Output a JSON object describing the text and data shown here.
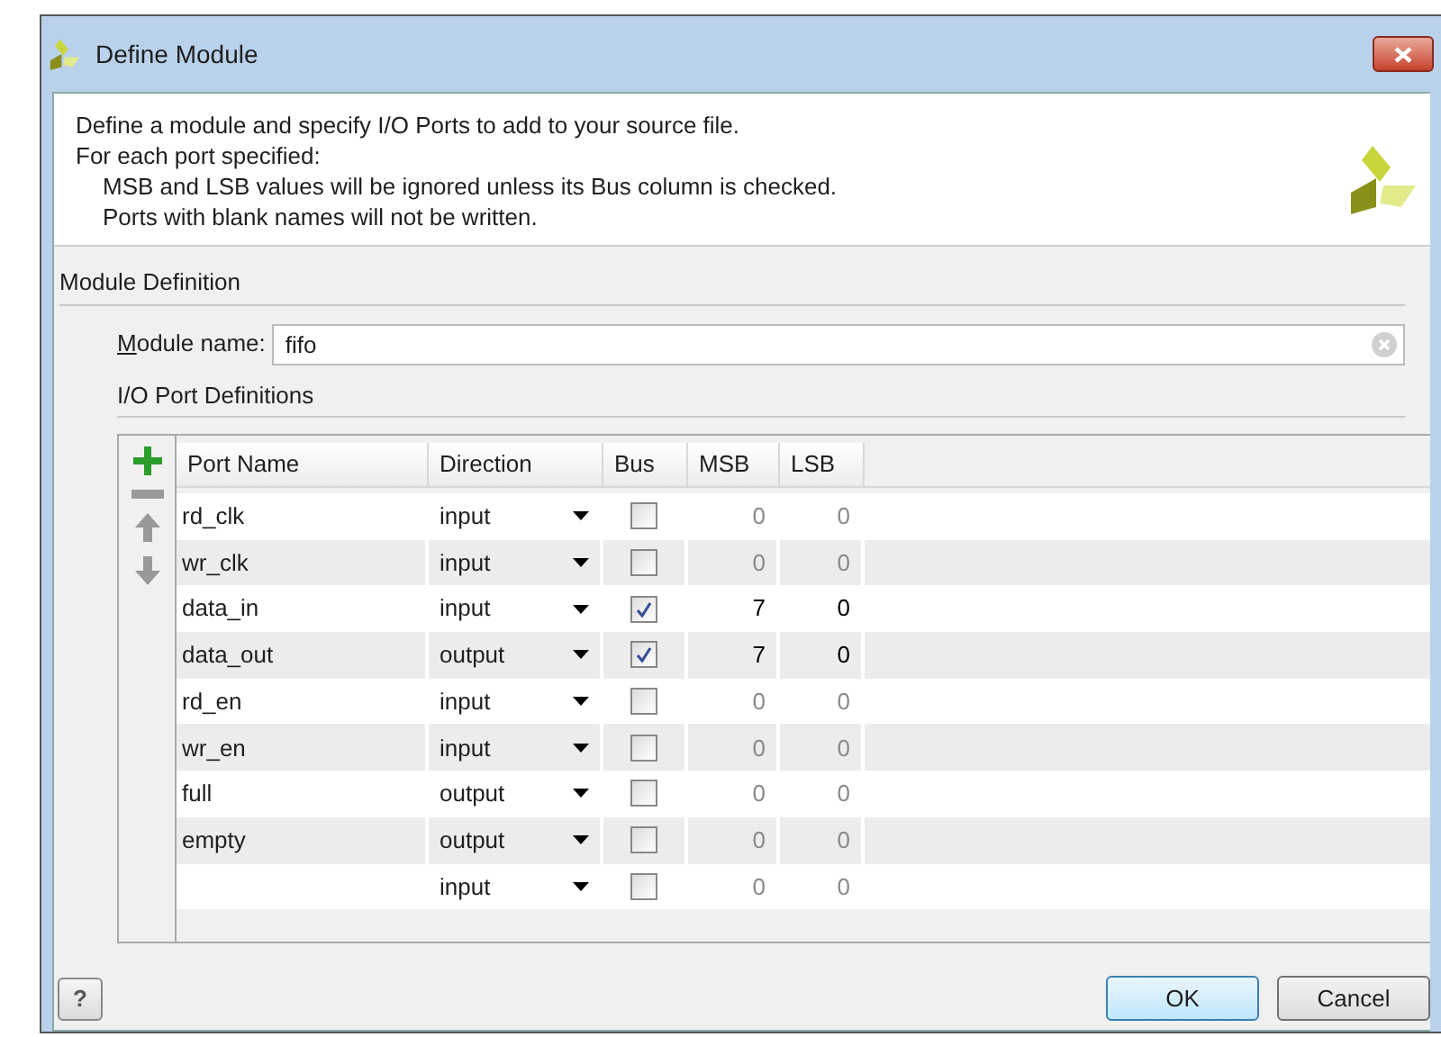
{
  "window": {
    "title": "Define Module"
  },
  "intro": {
    "lines": [
      "Define a module and specify I/O Ports to add to your source file.",
      "For each port specified:"
    ],
    "bullets": [
      "MSB and LSB values will be ignored unless its Bus column is checked.",
      "Ports with blank names will not be written."
    ]
  },
  "module_definition": {
    "heading": "Module Definition",
    "name_label": "Module name:",
    "name_value": "fifo"
  },
  "ports": {
    "heading": "I/O Port Definitions",
    "columns": [
      "Port Name",
      "Direction",
      "Bus",
      "MSB",
      "LSB"
    ],
    "rows": [
      {
        "name": "rd_clk",
        "direction": "input",
        "bus": false,
        "msb": "0",
        "lsb": "0"
      },
      {
        "name": "wr_clk",
        "direction": "input",
        "bus": false,
        "msb": "0",
        "lsb": "0"
      },
      {
        "name": "data_in",
        "direction": "input",
        "bus": true,
        "msb": "7",
        "lsb": "0"
      },
      {
        "name": "data_out",
        "direction": "output",
        "bus": true,
        "msb": "7",
        "lsb": "0"
      },
      {
        "name": "rd_en",
        "direction": "input",
        "bus": false,
        "msb": "0",
        "lsb": "0"
      },
      {
        "name": "wr_en",
        "direction": "input",
        "bus": false,
        "msb": "0",
        "lsb": "0"
      },
      {
        "name": "full",
        "direction": "output",
        "bus": false,
        "msb": "0",
        "lsb": "0"
      },
      {
        "name": "empty",
        "direction": "output",
        "bus": false,
        "msb": "0",
        "lsb": "0"
      },
      {
        "name": "",
        "direction": "input",
        "bus": false,
        "msb": "0",
        "lsb": "0"
      }
    ]
  },
  "buttons": {
    "help": "?",
    "ok": "OK",
    "cancel": "Cancel"
  }
}
